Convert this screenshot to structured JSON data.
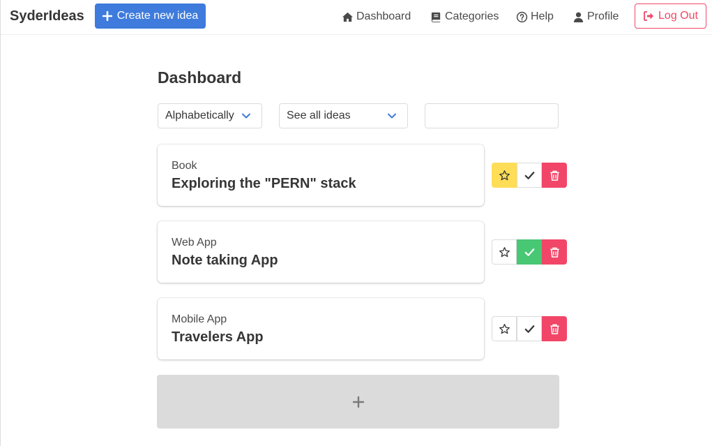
{
  "navbar": {
    "brand": "SyderIdeas",
    "create_label": "Create new idea",
    "items": [
      {
        "label": "Dashboard",
        "icon": "home-icon"
      },
      {
        "label": "Categories",
        "icon": "book-icon"
      },
      {
        "label": "Help",
        "icon": "question-circle-icon"
      },
      {
        "label": "Profile",
        "icon": "user-icon"
      }
    ],
    "logout_label": "Log Out"
  },
  "main": {
    "title": "Dashboard",
    "sort_select": {
      "value": "Alphabetically"
    },
    "filter_select": {
      "value": "See all ideas"
    },
    "search": {
      "value": "",
      "placeholder": ""
    },
    "ideas": [
      {
        "category": "Book",
        "name": "Exploring the \"PERN\" stack",
        "starred": true,
        "done": false
      },
      {
        "category": "Web App",
        "name": "Note taking App",
        "starred": false,
        "done": true
      },
      {
        "category": "Mobile App",
        "name": "Travelers App",
        "starred": false,
        "done": false
      }
    ],
    "add_icon": "plus-icon"
  },
  "colors": {
    "primary": "#3e7bdc",
    "danger": "#f14668",
    "warning": "#ffdd57",
    "success": "#48c774",
    "add_box": "#dbdbdb"
  }
}
